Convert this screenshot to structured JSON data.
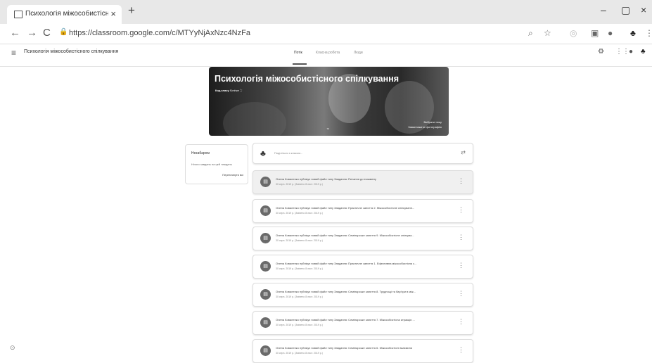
{
  "browser": {
    "tab_title": "Психологія міжособистісного с",
    "tab_close": "×",
    "new_tab": "+",
    "url": "https://classroom.google.com/c/MTYyNjAxNzc4NzFa",
    "window_controls": [
      "–",
      "▢",
      "×"
    ]
  },
  "app": {
    "course_name": "Психологія міжособистісного спілкування",
    "tabs": [
      "Потік",
      "Класна робота",
      "Люди"
    ]
  },
  "banner": {
    "title": "Психологія міжособистісного спілкування",
    "code_label": "Код класу",
    "code_value": "f1mhwr",
    "select_theme": "Вибрати тему",
    "upload_photo": "Завантажити фотографію"
  },
  "upcoming": {
    "title": "Незабаром",
    "subtitle": "Нічого завдань на цей тиждень",
    "link": "Переглянути всі"
  },
  "share": {
    "placeholder": "Поділіться з класом..."
  },
  "posts": [
    {
      "text": "Олена Коваленко публікує новий файл типу Завдання: Питання до екзамену",
      "date": "30 серп. 2019 р. (Змінено 8 лист. 2019 р.)"
    },
    {
      "text": "Олена Коваленко публікує новий файл типу Завдання: Практичне заняття 2. Міжособистісне спілкуванн...",
      "date": "30 серп. 2019 р. (Змінено 8 лист. 2019 р.)"
    },
    {
      "text": "Олена Коваленко публікує новий файл типу Завдання: Семінарське заняття 9. Міжособистісне спілкува...",
      "date": "30 серп. 2019 р. (Змінено 8 лист. 2019 р.)"
    },
    {
      "text": "Олена Коваленко публікує новий файл типу Завдання: Практичне заняття 1. Ефективна міжособистісна с...",
      "date": "30 серп. 2019 р. (Змінено 8 лист. 2019 р.)"
    },
    {
      "text": "Олена Коваленко публікує новий файл типу Завдання: Семінарське заняття 8. Труднощі та бар'єри в між...",
      "date": "30 серп. 2019 р. (Змінено 8 лист. 2019 р.)"
    },
    {
      "text": "Олена Коваленко публікує новий файл типу Завдання: Семінарське заняття 7. Міжособистісна атракція ...",
      "date": "30 серп. 2019 р. (Змінено 8 лист. 2019 р.)"
    },
    {
      "text": "Олена Коваленко публікує новий файл типу Завдання: Семінарське заняття 6. Міжособистісні взаємини",
      "date": "30 серп. 2019 р. (Змінено 8 лист. 2019 р.)"
    }
  ],
  "colors": {
    "tabbar": "#e8e8e8",
    "post_icon": "#6a6a6a",
    "highlight": "#f0f0f0"
  }
}
